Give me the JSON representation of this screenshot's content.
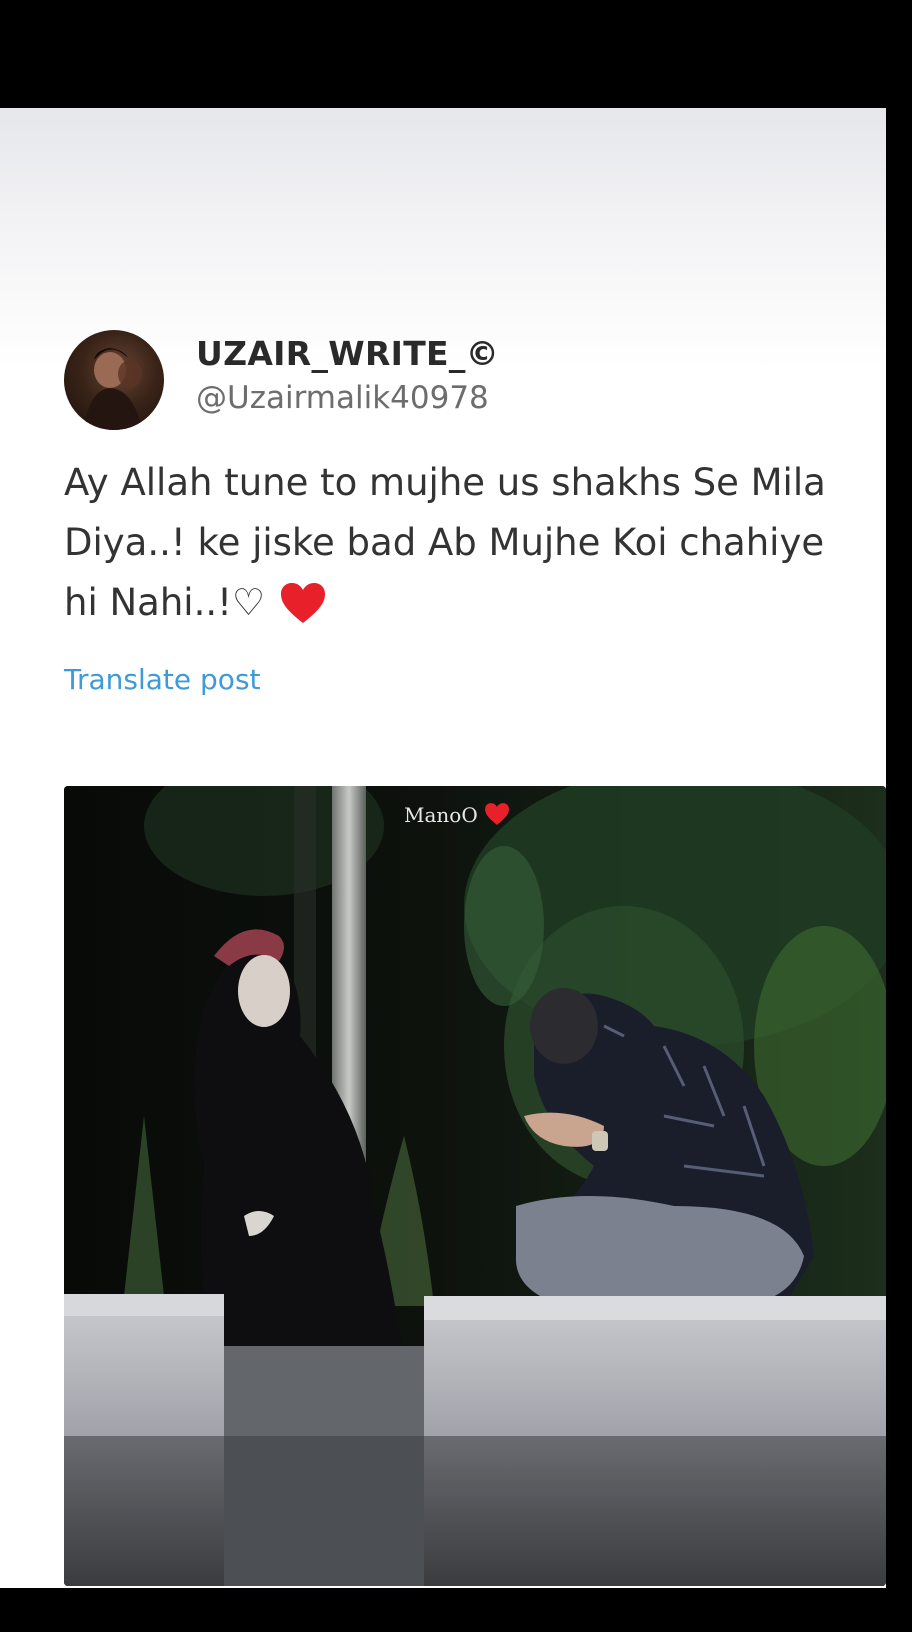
{
  "post": {
    "author": {
      "display_name": "UZAIR_WRITE_©",
      "handle": "@Uzairmalik40978",
      "avatar_icon": "profile-photo"
    },
    "text": "Ay Allah tune to mujhe us shakhs Se Mila Diya..! ke jiske bad Ab Mujhe Koi chahiye hi Nahi..!♡",
    "emoji_icon": "red-heart-icon",
    "translate_label": "Translate post",
    "media": {
      "watermark": "ManoO",
      "watermark_icon": "red-heart-icon"
    }
  },
  "colors": {
    "heart": "#e8202a",
    "translate_link": "#3d9bd8",
    "name": "#2a2a2a",
    "handle": "#6d6d6d",
    "text": "#333333"
  }
}
